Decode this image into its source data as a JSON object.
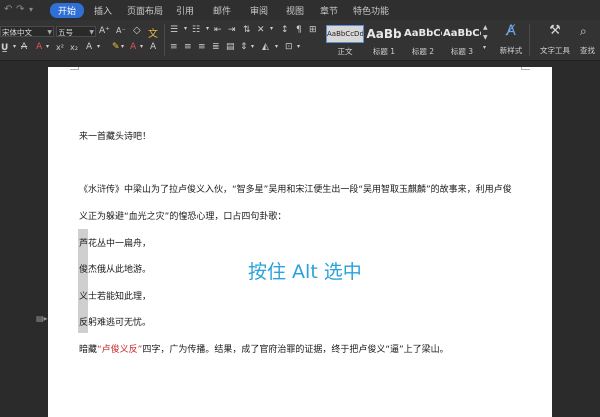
{
  "menubar": {
    "quick_icons": [
      "undo-icon",
      "redo-icon",
      "dropdown-icon"
    ],
    "tabs": [
      {
        "label": "开始",
        "active": true
      },
      {
        "label": "插入"
      },
      {
        "label": "页面布局"
      },
      {
        "label": "引用"
      },
      {
        "label": "邮件"
      },
      {
        "label": "审阅"
      },
      {
        "label": "视图"
      },
      {
        "label": "章节"
      },
      {
        "label": "特色功能"
      }
    ]
  },
  "ribbon": {
    "font_name": "宋体中文",
    "font_size": "五号",
    "style_gallery": [
      {
        "preview": "AaBbCcDd",
        "label": "正文"
      },
      {
        "preview": "AaBb",
        "label": "标题 1"
      },
      {
        "preview": "AaBbCc",
        "label": "标题 2"
      },
      {
        "preview": "AaBbCc",
        "label": "标题 3"
      }
    ],
    "new_style_label": "新样式",
    "text_tools_label": "文字工具",
    "find_replace_label": "查找"
  },
  "document": {
    "lines": [
      "来一首藏头诗吧！",
      "《水浒传》中梁山为了拉卢俊义入伙，“智多星”吴用和宋江便生出一段“吴用智取玉麒麟”的故事来，利用卢俊",
      "义正为躲避“血光之灾”的惶恐心理，口占四句卦歌：",
      "芦花丛中一扁舟，",
      "俊杰俄从此地游。",
      "义士若能知此理，",
      "反躬难逃可无忧。"
    ],
    "last_line_prefix": "暗藏",
    "last_line_highlight": "“卢俊义反”",
    "last_line_suffix": "四字，广为传播。结果，成了官府治罪的证据，终于把卢俊义“逼”上了梁山。",
    "overlay_hint": "按住 Alt 选中"
  },
  "colors": {
    "accent_tab": "#2f6fd6",
    "overlay_text": "#2aa2dc",
    "highlight_red": "#c8282b"
  }
}
